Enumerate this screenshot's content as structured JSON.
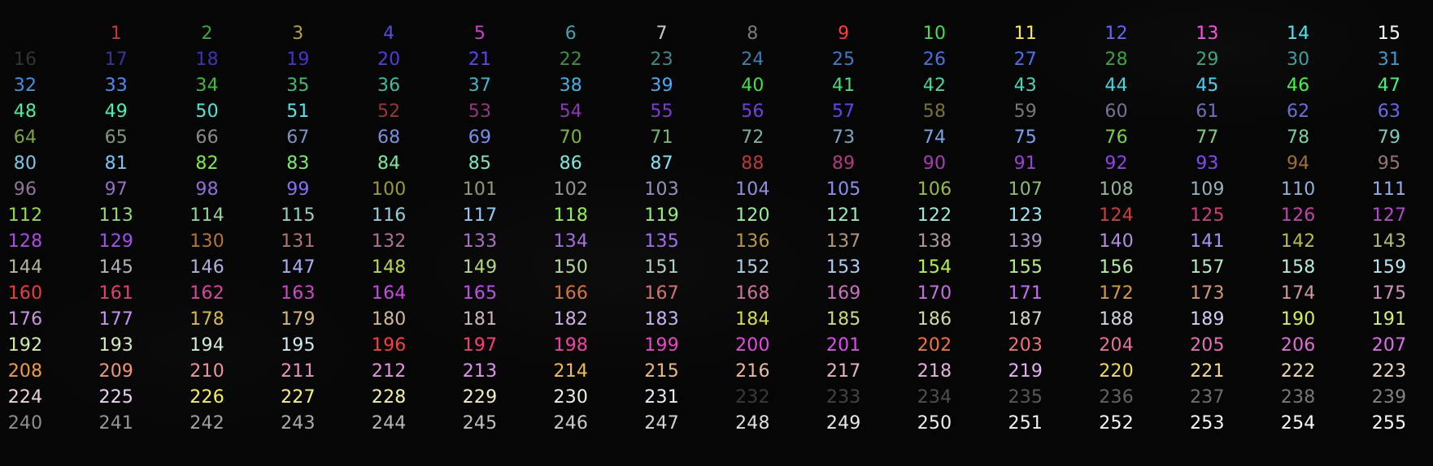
{
  "terminal": {
    "title": "",
    "cells": [
      {
        "text": "1",
        "color": "#bf3a3a"
      },
      {
        "text": "2",
        "color": "#37a83a"
      },
      {
        "text": "3",
        "color": "#b9a531"
      },
      {
        "text": "4",
        "color": "#5551d6"
      },
      {
        "text": "5",
        "color": "#d23ed2"
      },
      {
        "text": "6",
        "color": "#3da6b0"
      },
      {
        "text": "7",
        "color": "#c8c8c8"
      },
      {
        "text": "8",
        "color": "#7a7a7a"
      },
      {
        "text": "9",
        "color": "#ff3b3b"
      },
      {
        "text": "10",
        "color": "#3fe04a"
      },
      {
        "text": "11",
        "color": "#ffe83a"
      },
      {
        "text": "12",
        "color": "#6a62ff"
      },
      {
        "text": "13",
        "color": "#ff4ee6"
      },
      {
        "text": "14",
        "color": "#4ee6ee"
      },
      {
        "text": "15",
        "color": "#ffffff"
      },
      {
        "text": "16",
        "color": "#333333"
      },
      {
        "text": "17",
        "color": "#3a3498"
      },
      {
        "text": "18",
        "color": "#4133b9"
      },
      {
        "text": "19",
        "color": "#4735cf"
      },
      {
        "text": "20",
        "color": "#513be1"
      },
      {
        "text": "21",
        "color": "#5a45ef"
      },
      {
        "text": "22",
        "color": "#3c8f3c"
      },
      {
        "text": "23",
        "color": "#3b8b8b"
      },
      {
        "text": "24",
        "color": "#3a7fad"
      },
      {
        "text": "25",
        "color": "#3f78cf"
      },
      {
        "text": "26",
        "color": "#4474e2"
      },
      {
        "text": "27",
        "color": "#4874f0"
      },
      {
        "text": "28",
        "color": "#3ba53b"
      },
      {
        "text": "29",
        "color": "#3da67c"
      },
      {
        "text": "30",
        "color": "#3ea1a0"
      },
      {
        "text": "31",
        "color": "#3f9bcc"
      },
      {
        "text": "32",
        "color": "#4193e7"
      },
      {
        "text": "33",
        "color": "#4b8ff5"
      },
      {
        "text": "34",
        "color": "#3cbe3c"
      },
      {
        "text": "35",
        "color": "#3cbe77"
      },
      {
        "text": "36",
        "color": "#3fbb9f"
      },
      {
        "text": "37",
        "color": "#41b6c5"
      },
      {
        "text": "38",
        "color": "#43b1e6"
      },
      {
        "text": "39",
        "color": "#4aacf8"
      },
      {
        "text": "40",
        "color": "#42e042"
      },
      {
        "text": "41",
        "color": "#43de76"
      },
      {
        "text": "42",
        "color": "#45da9a"
      },
      {
        "text": "43",
        "color": "#47d7bd"
      },
      {
        "text": "44",
        "color": "#49d3e0"
      },
      {
        "text": "45",
        "color": "#4dcff8"
      },
      {
        "text": "46",
        "color": "#47f547"
      },
      {
        "text": "47",
        "color": "#48f378"
      },
      {
        "text": "48",
        "color": "#49f199"
      },
      {
        "text": "49",
        "color": "#4aeeba"
      },
      {
        "text": "50",
        "color": "#4cebd6"
      },
      {
        "text": "51",
        "color": "#4fe9f2"
      },
      {
        "text": "52",
        "color": "#9e3434"
      },
      {
        "text": "53",
        "color": "#98357e"
      },
      {
        "text": "54",
        "color": "#8e37b7"
      },
      {
        "text": "55",
        "color": "#8139d3"
      },
      {
        "text": "56",
        "color": "#723ee6"
      },
      {
        "text": "57",
        "color": "#6743f4"
      },
      {
        "text": "58",
        "color": "#7b7332"
      },
      {
        "text": "59",
        "color": "#777777"
      },
      {
        "text": "60",
        "color": "#74749a"
      },
      {
        "text": "61",
        "color": "#7070bd"
      },
      {
        "text": "62",
        "color": "#6d6cdb"
      },
      {
        "text": "63",
        "color": "#6a69f0"
      },
      {
        "text": "64",
        "color": "#7ea537"
      },
      {
        "text": "65",
        "color": "#7a9a7a"
      },
      {
        "text": "66",
        "color": "#8b8b8b"
      },
      {
        "text": "67",
        "color": "#7d93c4"
      },
      {
        "text": "68",
        "color": "#7b90de"
      },
      {
        "text": "69",
        "color": "#798ef1"
      },
      {
        "text": "70",
        "color": "#7ab83d"
      },
      {
        "text": "71",
        "color": "#79b473"
      },
      {
        "text": "72",
        "color": "#7eae9e"
      },
      {
        "text": "73",
        "color": "#7aaac1"
      },
      {
        "text": "74",
        "color": "#78a7e0"
      },
      {
        "text": "75",
        "color": "#77a4f5"
      },
      {
        "text": "76",
        "color": "#77d540"
      },
      {
        "text": "77",
        "color": "#79d376"
      },
      {
        "text": "78",
        "color": "#7acfa0"
      },
      {
        "text": "79",
        "color": "#7acbc1"
      },
      {
        "text": "80",
        "color": "#79c8e4"
      },
      {
        "text": "81",
        "color": "#7ac5f8"
      },
      {
        "text": "82",
        "color": "#7aef44"
      },
      {
        "text": "83",
        "color": "#7bed75"
      },
      {
        "text": "84",
        "color": "#7deb99"
      },
      {
        "text": "85",
        "color": "#7fe8ba"
      },
      {
        "text": "86",
        "color": "#80e6d9"
      },
      {
        "text": "87",
        "color": "#83e4f3"
      },
      {
        "text": "88",
        "color": "#b83a3a"
      },
      {
        "text": "89",
        "color": "#b03c7d"
      },
      {
        "text": "90",
        "color": "#a43eb2"
      },
      {
        "text": "91",
        "color": "#9a40d2"
      },
      {
        "text": "92",
        "color": "#8e44e6"
      },
      {
        "text": "93",
        "color": "#8449f4"
      },
      {
        "text": "94",
        "color": "#9a7335"
      },
      {
        "text": "95",
        "color": "#977575"
      },
      {
        "text": "96",
        "color": "#93749a"
      },
      {
        "text": "97",
        "color": "#9171c0"
      },
      {
        "text": "98",
        "color": "#8e70dd"
      },
      {
        "text": "99",
        "color": "#8b6ff2"
      },
      {
        "text": "100",
        "color": "#9a9a3a"
      },
      {
        "text": "101",
        "color": "#979778"
      },
      {
        "text": "102",
        "color": "#96969a"
      },
      {
        "text": "103",
        "color": "#9393bf"
      },
      {
        "text": "104",
        "color": "#9090de"
      },
      {
        "text": "105",
        "color": "#8e8ff2"
      },
      {
        "text": "106",
        "color": "#95bd42"
      },
      {
        "text": "107",
        "color": "#93ba74"
      },
      {
        "text": "108",
        "color": "#93b69b"
      },
      {
        "text": "109",
        "color": "#93b3bc"
      },
      {
        "text": "110",
        "color": "#91b0df"
      },
      {
        "text": "111",
        "color": "#90aef6"
      },
      {
        "text": "112",
        "color": "#92da45"
      },
      {
        "text": "113",
        "color": "#92d878"
      },
      {
        "text": "114",
        "color": "#92d59c"
      },
      {
        "text": "115",
        "color": "#92d2bc"
      },
      {
        "text": "116",
        "color": "#92cfdf"
      },
      {
        "text": "117",
        "color": "#92ccf6"
      },
      {
        "text": "118",
        "color": "#94f347"
      },
      {
        "text": "119",
        "color": "#95f179"
      },
      {
        "text": "120",
        "color": "#96ef9b"
      },
      {
        "text": "121",
        "color": "#97edba"
      },
      {
        "text": "122",
        "color": "#98ebd9"
      },
      {
        "text": "123",
        "color": "#99e9f3"
      },
      {
        "text": "124",
        "color": "#d13d3d"
      },
      {
        "text": "125",
        "color": "#cc3f77"
      },
      {
        "text": "126",
        "color": "#c343ad"
      },
      {
        "text": "127",
        "color": "#b847d2"
      },
      {
        "text": "128",
        "color": "#ac4be7"
      },
      {
        "text": "129",
        "color": "#a24ff4"
      },
      {
        "text": "130",
        "color": "#b77335"
      },
      {
        "text": "131",
        "color": "#b27474"
      },
      {
        "text": "132",
        "color": "#ae739b"
      },
      {
        "text": "133",
        "color": "#aa71c0"
      },
      {
        "text": "134",
        "color": "#a670df"
      },
      {
        "text": "135",
        "color": "#a26ff3"
      },
      {
        "text": "136",
        "color": "#b89a3c"
      },
      {
        "text": "137",
        "color": "#b59777"
      },
      {
        "text": "138",
        "color": "#b2969a"
      },
      {
        "text": "139",
        "color": "#af94bf"
      },
      {
        "text": "140",
        "color": "#ad92de"
      },
      {
        "text": "141",
        "color": "#aa91f2"
      },
      {
        "text": "142",
        "color": "#b9bd45"
      },
      {
        "text": "143",
        "color": "#b6ba78"
      },
      {
        "text": "144",
        "color": "#b4b79c"
      },
      {
        "text": "145",
        "color": "#b1b4bd"
      },
      {
        "text": "146",
        "color": "#afb1df"
      },
      {
        "text": "147",
        "color": "#adaff6"
      },
      {
        "text": "148",
        "color": "#b8da47"
      },
      {
        "text": "149",
        "color": "#b6d87a"
      },
      {
        "text": "150",
        "color": "#b4d59d"
      },
      {
        "text": "151",
        "color": "#b2d2bd"
      },
      {
        "text": "152",
        "color": "#b1cfde"
      },
      {
        "text": "153",
        "color": "#b0cdf6"
      },
      {
        "text": "154",
        "color": "#b6f34a"
      },
      {
        "text": "155",
        "color": "#b5f17b"
      },
      {
        "text": "156",
        "color": "#b5ef9e"
      },
      {
        "text": "157",
        "color": "#b4edbd"
      },
      {
        "text": "158",
        "color": "#b3ebdb"
      },
      {
        "text": "159",
        "color": "#b3e9f3"
      },
      {
        "text": "160",
        "color": "#ea3e3e"
      },
      {
        "text": "161",
        "color": "#e43f73"
      },
      {
        "text": "162",
        "color": "#dd42a5"
      },
      {
        "text": "163",
        "color": "#d445cc"
      },
      {
        "text": "164",
        "color": "#cb49e3"
      },
      {
        "text": "165",
        "color": "#c24df2"
      },
      {
        "text": "166",
        "color": "#d77437"
      },
      {
        "text": "167",
        "color": "#d37373"
      },
      {
        "text": "168",
        "color": "#cf729a"
      },
      {
        "text": "169",
        "color": "#cb71bf"
      },
      {
        "text": "170",
        "color": "#c76fdd"
      },
      {
        "text": "171",
        "color": "#c36ef2"
      },
      {
        "text": "172",
        "color": "#d69a3e"
      },
      {
        "text": "173",
        "color": "#d39778"
      },
      {
        "text": "174",
        "color": "#d0969b"
      },
      {
        "text": "175",
        "color": "#cd94bf"
      },
      {
        "text": "176",
        "color": "#cb93de"
      },
      {
        "text": "177",
        "color": "#c891f2"
      },
      {
        "text": "178",
        "color": "#d5bc47"
      },
      {
        "text": "179",
        "color": "#d3ba7a"
      },
      {
        "text": "180",
        "color": "#d0b79d"
      },
      {
        "text": "181",
        "color": "#ceb4be"
      },
      {
        "text": "182",
        "color": "#ccb1df"
      },
      {
        "text": "183",
        "color": "#cab0f5"
      },
      {
        "text": "184",
        "color": "#d5dd49"
      },
      {
        "text": "185",
        "color": "#d3db7b"
      },
      {
        "text": "186",
        "color": "#d1d8a0"
      },
      {
        "text": "187",
        "color": "#cfd5bf"
      },
      {
        "text": "188",
        "color": "#ced2df"
      },
      {
        "text": "189",
        "color": "#cdd0f6"
      },
      {
        "text": "190",
        "color": "#d4f34c"
      },
      {
        "text": "191",
        "color": "#d3f17d"
      },
      {
        "text": "192",
        "color": "#d2ef9f"
      },
      {
        "text": "193",
        "color": "#d1edbe"
      },
      {
        "text": "194",
        "color": "#d1ebdc"
      },
      {
        "text": "195",
        "color": "#d0e9f3"
      },
      {
        "text": "196",
        "color": "#ff3f3f"
      },
      {
        "text": "197",
        "color": "#fb4070"
      },
      {
        "text": "198",
        "color": "#f642a0"
      },
      {
        "text": "199",
        "color": "#ef45c6"
      },
      {
        "text": "200",
        "color": "#e748e3"
      },
      {
        "text": "201",
        "color": "#df4cf3"
      },
      {
        "text": "202",
        "color": "#f47439"
      },
      {
        "text": "203",
        "color": "#f07272"
      },
      {
        "text": "204",
        "color": "#ec7198"
      },
      {
        "text": "205",
        "color": "#e870bd"
      },
      {
        "text": "206",
        "color": "#e46ddb"
      },
      {
        "text": "207",
        "color": "#e06cf1"
      },
      {
        "text": "208",
        "color": "#f29a40"
      },
      {
        "text": "209",
        "color": "#ef9879"
      },
      {
        "text": "210",
        "color": "#ec969b"
      },
      {
        "text": "211",
        "color": "#e994bf"
      },
      {
        "text": "212",
        "color": "#e693de"
      },
      {
        "text": "213",
        "color": "#e391f2"
      },
      {
        "text": "214",
        "color": "#f2bd49"
      },
      {
        "text": "215",
        "color": "#efba7b"
      },
      {
        "text": "216",
        "color": "#ecb79e"
      },
      {
        "text": "217",
        "color": "#e9b4bf"
      },
      {
        "text": "218",
        "color": "#e7b1de"
      },
      {
        "text": "219",
        "color": "#e5b0f4"
      },
      {
        "text": "220",
        "color": "#f2de4b"
      },
      {
        "text": "221",
        "color": "#f0dc7d"
      },
      {
        "text": "222",
        "color": "#eed9a0"
      },
      {
        "text": "223",
        "color": "#ecd6c0"
      },
      {
        "text": "224",
        "color": "#ebd3df"
      },
      {
        "text": "225",
        "color": "#ead2f5"
      },
      {
        "text": "226",
        "color": "#f6f64a"
      },
      {
        "text": "227",
        "color": "#f6f47f"
      },
      {
        "text": "228",
        "color": "#f5f1a3"
      },
      {
        "text": "229",
        "color": "#f4eec3"
      },
      {
        "text": "230",
        "color": "#f3ecdf"
      },
      {
        "text": "231",
        "color": "#f2eaf5"
      },
      {
        "text": "232",
        "color": "#3a3a3a"
      },
      {
        "text": "233",
        "color": "#444444"
      },
      {
        "text": "234",
        "color": "#4f4f4f"
      },
      {
        "text": "235",
        "color": "#595959"
      },
      {
        "text": "236",
        "color": "#636363"
      },
      {
        "text": "237",
        "color": "#6e6e6e"
      },
      {
        "text": "238",
        "color": "#787878"
      },
      {
        "text": "239",
        "color": "#828282"
      },
      {
        "text": "240",
        "color": "#8d8d8d"
      },
      {
        "text": "241",
        "color": "#979797"
      },
      {
        "text": "242",
        "color": "#a1a1a1"
      },
      {
        "text": "243",
        "color": "#acacac"
      },
      {
        "text": "244",
        "color": "#b6b6b6"
      },
      {
        "text": "245",
        "color": "#c0c0c0"
      },
      {
        "text": "246",
        "color": "#cacaca"
      },
      {
        "text": "247",
        "color": "#d5d5d5"
      },
      {
        "text": "248",
        "color": "#dfdfdf"
      },
      {
        "text": "249",
        "color": "#e9e9e9"
      },
      {
        "text": "250",
        "color": "#eeeeee"
      },
      {
        "text": "251",
        "color": "#f3f3f3"
      },
      {
        "text": "252",
        "color": "#f6f6f6"
      },
      {
        "text": "253",
        "color": "#f9f9f9"
      },
      {
        "text": "254",
        "color": "#fcfcfc"
      },
      {
        "text": "255",
        "color": "#ffffff"
      }
    ]
  }
}
